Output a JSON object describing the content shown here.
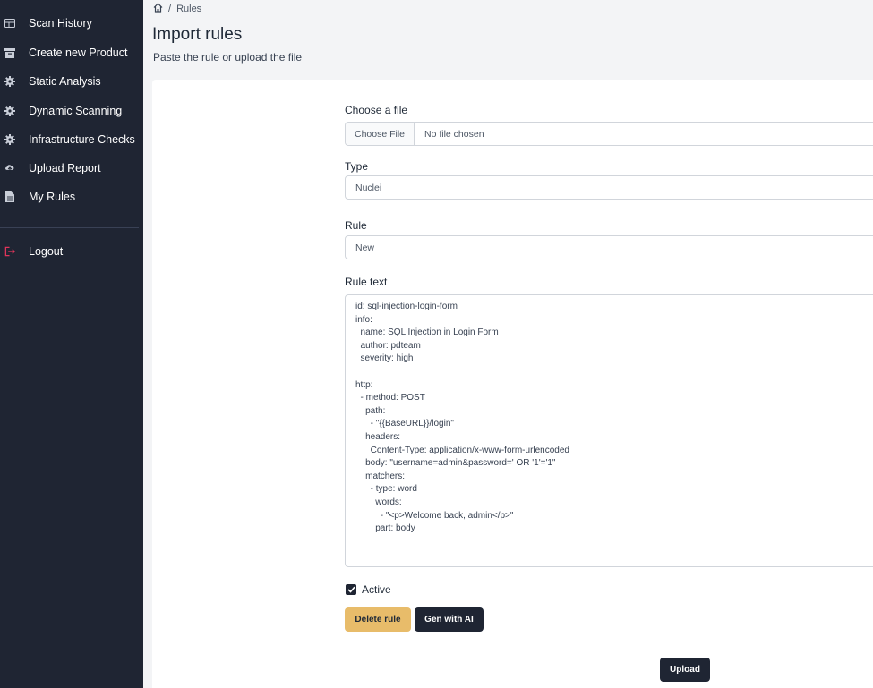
{
  "sidebar": {
    "items": [
      {
        "label": "Scan History",
        "icon": "table-icon"
      },
      {
        "label": "Create new Product",
        "icon": "archive-icon"
      },
      {
        "label": "Static Analysis",
        "icon": "gear-icon"
      },
      {
        "label": "Dynamic Scanning",
        "icon": "gear-icon"
      },
      {
        "label": "Infrastructure Checks",
        "icon": "gear-icon"
      },
      {
        "label": "Upload Report",
        "icon": "cloud-upload-icon"
      },
      {
        "label": "My Rules",
        "icon": "document-icon"
      }
    ],
    "logout": {
      "label": "Logout",
      "icon": "logout-icon"
    }
  },
  "breadcrumb": {
    "sep": "/",
    "current": "Rules"
  },
  "page": {
    "title": "Import rules",
    "subtitle": "Paste the rule or upload the file"
  },
  "form": {
    "file": {
      "label": "Choose a file",
      "button": "Choose File",
      "status": "No file chosen"
    },
    "type": {
      "label": "Type",
      "value": "Nuclei"
    },
    "rule": {
      "label": "Rule",
      "value": "New"
    },
    "rule_text": {
      "label": "Rule text",
      "value": "id: sql-injection-login-form\ninfo:\n  name: SQL Injection in Login Form\n  author: pdteam\n  severity: high\n\nhttp:\n  - method: POST\n    path:\n      - \"{{BaseURL}}/login\"\n    headers:\n      Content-Type: application/x-www-form-urlencoded\n    body: \"username=admin&password=' OR '1'='1\"\n    matchers:\n      - type: word\n        words:\n          - \"<p>Welcome back, admin</p>\"\n        part: body"
    },
    "active": {
      "label": "Active",
      "checked": true
    },
    "delete_label": "Delete rule",
    "gen_label": "Gen with AI",
    "upload_label": "Upload"
  },
  "colors": {
    "sidebar_bg": "#1f2533",
    "accent_yellow": "#e8bc6a",
    "logout_icon": "#e0345a"
  }
}
